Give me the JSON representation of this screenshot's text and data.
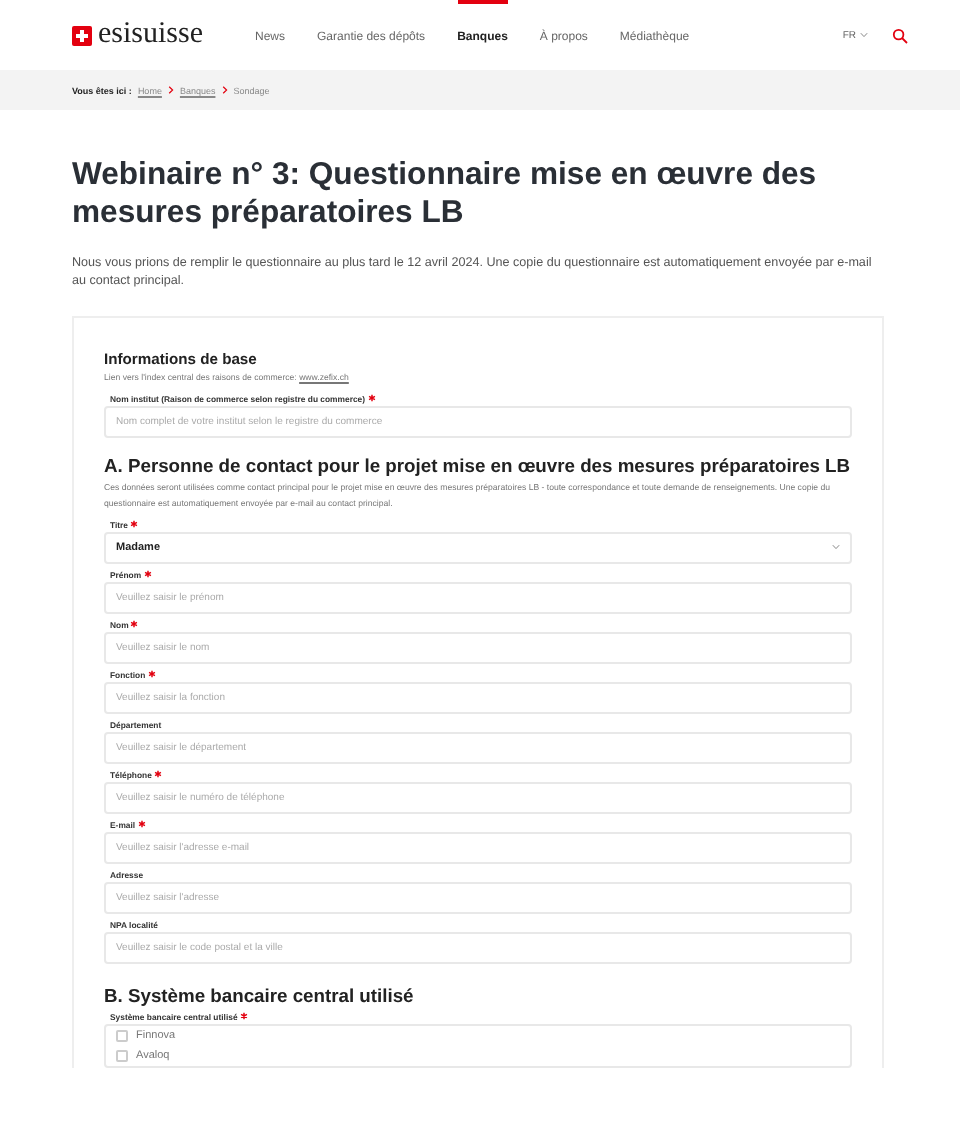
{
  "header": {
    "logo": "esisuisse",
    "nav": [
      {
        "label": "News",
        "selected": false
      },
      {
        "label": "Garantie des dépôts",
        "selected": false
      },
      {
        "label": "Banques",
        "selected": true
      },
      {
        "label": "À propos",
        "selected": false
      },
      {
        "label": "Médiathèque",
        "selected": false
      }
    ],
    "language": "FR"
  },
  "breadcrumb": {
    "prefix": "Vous êtes ici :",
    "items": [
      "Home",
      "Banques",
      "Sondage"
    ]
  },
  "title": "Webinaire n° 3: Questionnaire mise en œuvre des mesures préparatoires LB",
  "intro": "Nous vous prions de remplir le questionnaire au plus tard le 12 avril 2024. Une copie du questionnaire est automatiquement envoyée par e-mail au contact principal.",
  "sections": [
    {
      "heading": "Informations de base",
      "kind": "sub",
      "text": "Lien vers l'index central des raisons de commerce:",
      "link": "www.zefix.ch",
      "fields": [
        {
          "kind": "text",
          "label": "Nom institut (Raison de commerce selon registre du commerce)",
          "required": true,
          "placeholder": "Nom complet de votre institut selon le registre du commerce"
        }
      ]
    },
    {
      "heading": "A. Personne de contact pour le projet mise en œuvre des mesures préparatoires LB",
      "kind": "main",
      "text": "Ces données seront utilisées comme contact principal pour le projet mise en œuvre des mesures préparatoires LB - toute correspondance et toute demande de renseignements. Une copie du questionnaire est automatiquement envoyée par e-mail au contact principal.",
      "fields": [
        {
          "kind": "select",
          "label": "Titre",
          "required": true,
          "value": "Madame"
        },
        {
          "kind": "text",
          "label": "Prénom",
          "required": true,
          "placeholder": "Veuillez saisir le prénom"
        },
        {
          "kind": "text",
          "label": "Nom",
          "required": true,
          "placeholder": "Veuillez saisir le nom"
        },
        {
          "kind": "text",
          "label": "Fonction",
          "required": true,
          "placeholder": "Veuillez saisir la fonction"
        },
        {
          "kind": "text",
          "label": "Département",
          "required": false,
          "placeholder": "Veuillez saisir le département"
        },
        {
          "kind": "text",
          "label": "Téléphone",
          "required": true,
          "placeholder": "Veuillez saisir le numéro de téléphone"
        },
        {
          "kind": "text",
          "label": "E-mail",
          "required": true,
          "placeholder": "Veuillez saisir l'adresse e-mail"
        },
        {
          "kind": "text",
          "label": "Adresse",
          "required": false,
          "placeholder": "Veuillez saisir l'adresse"
        },
        {
          "kind": "text",
          "label": "NPA localité",
          "required": false,
          "placeholder": "Veuillez saisir le code postal et la ville"
        }
      ]
    },
    {
      "heading": "B. Système bancaire central utilisé",
      "kind": "main",
      "fields": [
        {
          "kind": "checkboxes",
          "label": "Système bancaire central utilisé",
          "required": true,
          "options": [
            {
              "label": "Finnova",
              "checked": false
            },
            {
              "label": "Avaloq",
              "checked": false
            }
          ]
        }
      ]
    }
  ]
}
